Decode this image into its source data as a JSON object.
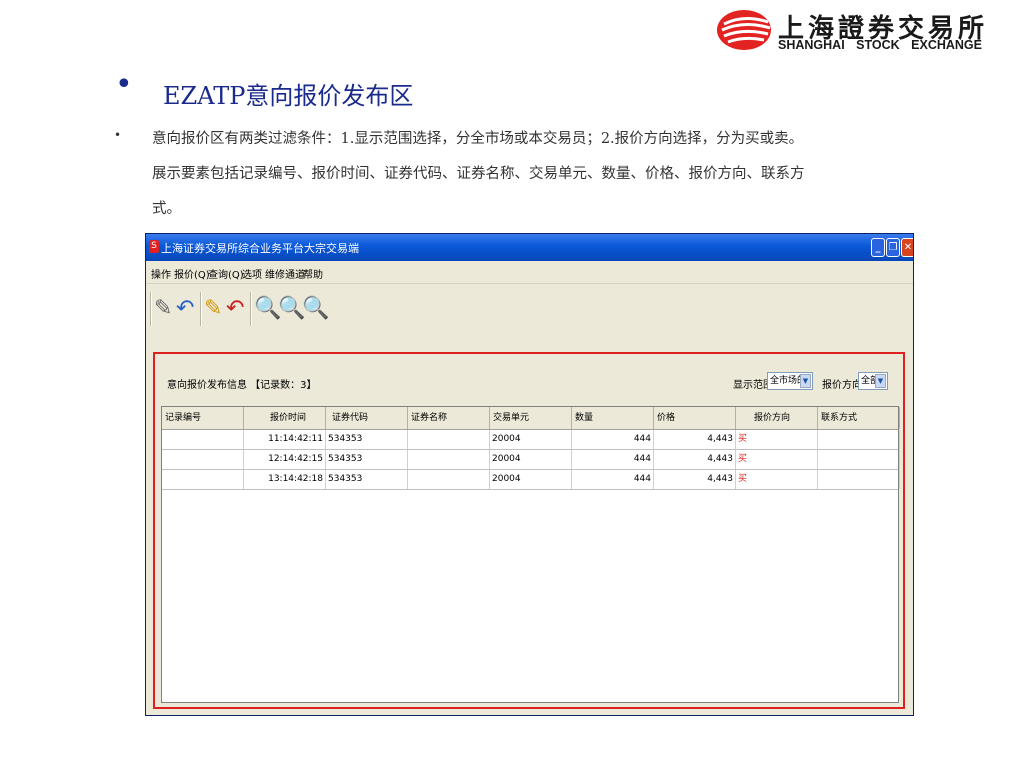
{
  "logo": {
    "cn": "上海證券交易所",
    "en": "SHANGHAI STOCK EXCHANGE"
  },
  "slide": {
    "bullet": "•",
    "title": "EZATP意向报价发布区",
    "text_bullet": "•",
    "lines": [
      "意向报价区有两类过滤条件：1.显示范围选择，分全市场或本交易员；2.报价方向选择，分为买或卖。",
      "展示要素包括记录编号、报价时间、证券代码、证券名称、交易单元、数量、价格、报价方向、联系方",
      "式。"
    ]
  },
  "window": {
    "title": "上海证券交易所综合业务平台大宗交易端",
    "menu": [
      "操作",
      "报价(Q)",
      "查询(Q)",
      "选项",
      "维修通道",
      "帮助"
    ],
    "panel": {
      "info": "意向报价发布信息 【记录数：3】",
      "range_label": "显示范围",
      "range_value": "全市场的",
      "direction_label": "报价方向",
      "direction_value": "全部",
      "columns": [
        "记录编号",
        "报价时间",
        "证券代码",
        "证券名称",
        "交易单元",
        "数量",
        "价格",
        "报价方向",
        "联系方式"
      ],
      "rows": [
        {
          "time": "11:14:42:11",
          "code": "534353",
          "name": "",
          "unit": "20004",
          "qty": "444",
          "price": "4,443",
          "dir": "买",
          "contact": ""
        },
        {
          "time": "12:14:42:15",
          "code": "534353",
          "name": "",
          "unit": "20004",
          "qty": "444",
          "price": "4,443",
          "dir": "买",
          "contact": ""
        },
        {
          "time": "13:14:42:18",
          "code": "534353",
          "name": "",
          "unit": "20004",
          "qty": "444",
          "price": "4,443",
          "dir": "买",
          "contact": ""
        }
      ]
    }
  }
}
